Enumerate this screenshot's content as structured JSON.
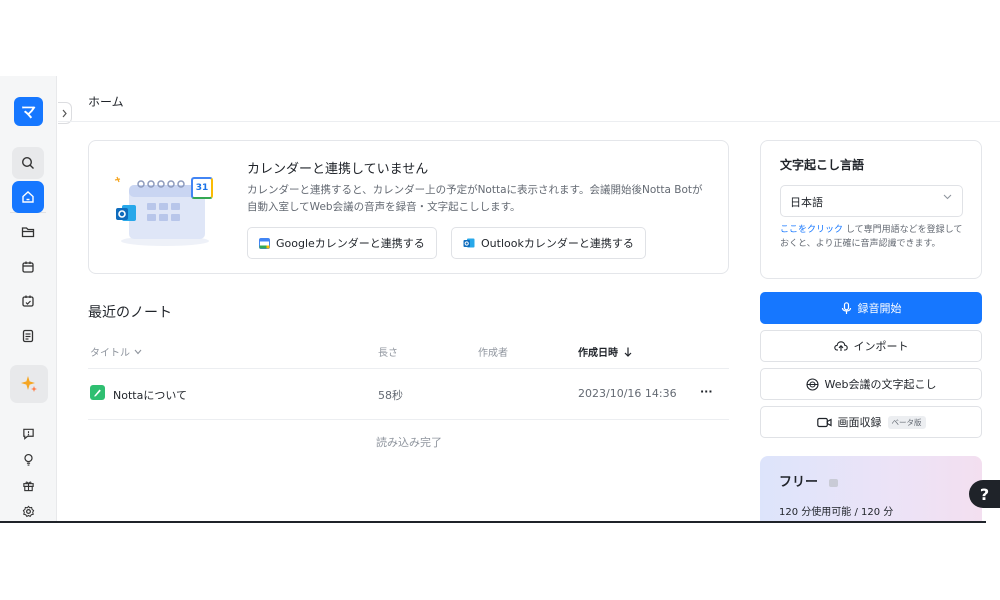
{
  "sidebar": {
    "logo_label": "マ",
    "items": [
      {
        "name": "search",
        "icon": "search-icon"
      },
      {
        "name": "home",
        "icon": "home-icon"
      },
      {
        "name": "folder",
        "icon": "folder-icon"
      },
      {
        "name": "calendar",
        "icon": "calendar-icon"
      },
      {
        "name": "schedule",
        "icon": "calendar-clock-icon"
      },
      {
        "name": "notes",
        "icon": "document-icon"
      },
      {
        "name": "ai",
        "icon": "sparkle-icon"
      },
      {
        "name": "feedback",
        "icon": "chat-icon"
      },
      {
        "name": "tips",
        "icon": "lightbulb-icon"
      },
      {
        "name": "gift",
        "icon": "gift-icon"
      },
      {
        "name": "settings",
        "icon": "gear-icon"
      }
    ]
  },
  "header": {
    "title": "ホーム"
  },
  "calendar_card": {
    "title": "カレンダーと連携していません",
    "description": "カレンダーと連携すると、カレンダー上の予定がNottaに表示されます。会議開始後Notta Botが自動入室してWeb会議の音声を録音・文字起こしします。",
    "calendar_day": "31",
    "google_button": "Googleカレンダーと連携する",
    "outlook_button": "Outlookカレンダーと連携する"
  },
  "notes": {
    "title": "最近のノート",
    "columns": {
      "title": "タイトル",
      "length": "長さ",
      "author": "作成者",
      "created": "作成日時"
    },
    "rows": [
      {
        "title": "Nottaについて",
        "length": "58秒",
        "author": "",
        "created": "2023/10/16 14:36",
        "more": "···"
      }
    ],
    "loaded_text": "読み込み完了"
  },
  "language_card": {
    "title": "文字起こし言語",
    "selected": "日本語",
    "hint_link": "ここをクリック",
    "hint_text": "して専門用語などを登録しておくと、より正確に音声認識できます。"
  },
  "actions": {
    "record": "録音開始",
    "import": "インポート",
    "web_meeting": "Web会議の文字起こし",
    "screen_record": "画面収録",
    "beta": "ベータ版"
  },
  "plan": {
    "title": "フリー",
    "usage": "120 分使用可能 / 120 分"
  },
  "help_label": "?",
  "colors": {
    "accent": "#1677ff",
    "sidebar_bg": "#f5f6f7",
    "note_icon": "#2fbf71"
  }
}
